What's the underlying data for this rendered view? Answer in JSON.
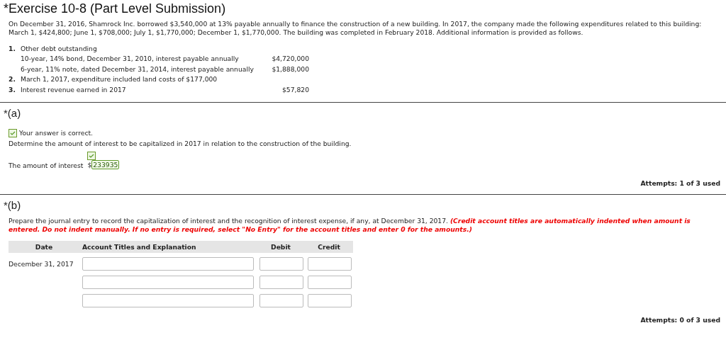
{
  "title": "*Exercise 10-8 (Part Level Submission)",
  "intro": "On December 31, 2016, Shamrock Inc. borrowed $3,540,000 at 13% payable annually to finance the construction of a new building. In 2017, the company made the following expenditures related to this building: March 1, $424,800; June 1, $708,000; July 1, $1,770,000; December 1, $1,770,000. The building was completed in February 2018. Additional information is provided as follows.",
  "info": [
    {
      "number": "1.",
      "label": "Other debt outstanding",
      "children": [
        {
          "label": "10-year, 14% bond, December 31, 2010, interest payable annually",
          "amount": "$4,720,000"
        },
        {
          "label": "6-year, 11% note, dated December 31, 2014, interest payable annually",
          "amount": "$1,888,000"
        }
      ]
    },
    {
      "number": "2.",
      "label": "March 1, 2017, expenditure included land costs of $177,000"
    },
    {
      "number": "3.",
      "label": "Interest revenue earned in 2017",
      "amount": "$57,820"
    }
  ],
  "part_a": {
    "heading": "*(a)",
    "correct": true,
    "feedback": "Your answer is correct.",
    "question": "Determine the amount of interest to be capitalized in 2017 in relation to the construction of the building.",
    "answer_label": "The amount of interest",
    "currency": "$",
    "answer_value": "233935",
    "attempts": "Attempts: 1 of 3 used"
  },
  "part_b": {
    "heading": "*(b)",
    "question": "Prepare the journal entry to record the capitalization of interest and the recognition of interest expense, if any, at December 31, 2017.",
    "note": "(Credit account titles are automatically indented when amount is entered. Do not indent manually. If no entry is required, select \"No Entry\" for the account titles and enter 0 for the amounts.)",
    "columns": [
      "Date",
      "Account Titles and Explanation",
      "Debit",
      "Credit"
    ],
    "rows": [
      {
        "date": "December 31, 2017"
      },
      {},
      {}
    ],
    "attempts": "Attempts: 0 of 3 used"
  }
}
